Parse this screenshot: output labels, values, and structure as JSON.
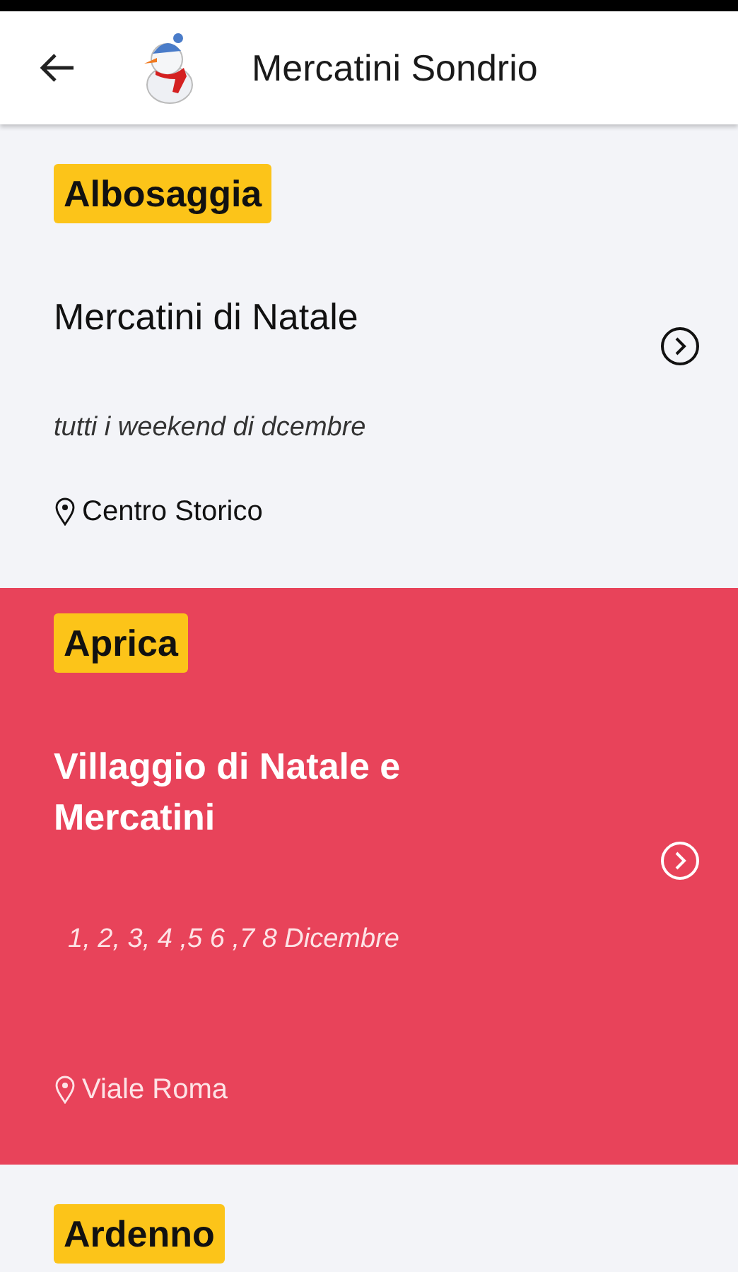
{
  "app_bar": {
    "title": "Mercatini Sondrio"
  },
  "events": [
    {
      "town": "Albosaggia",
      "title": "Mercatini di Natale",
      "dates": "tutti i weekend di dcembre",
      "location": "Centro Storico",
      "selected": false
    },
    {
      "town": "Aprica",
      "title": "Villaggio di Natale e Mercatini",
      "dates": "1, 2, 3, 4 ,5 6 ,7 8 Dicembre",
      "location": "Viale Roma",
      "selected": true
    },
    {
      "town": "Ardenno",
      "selected": false
    }
  ]
}
